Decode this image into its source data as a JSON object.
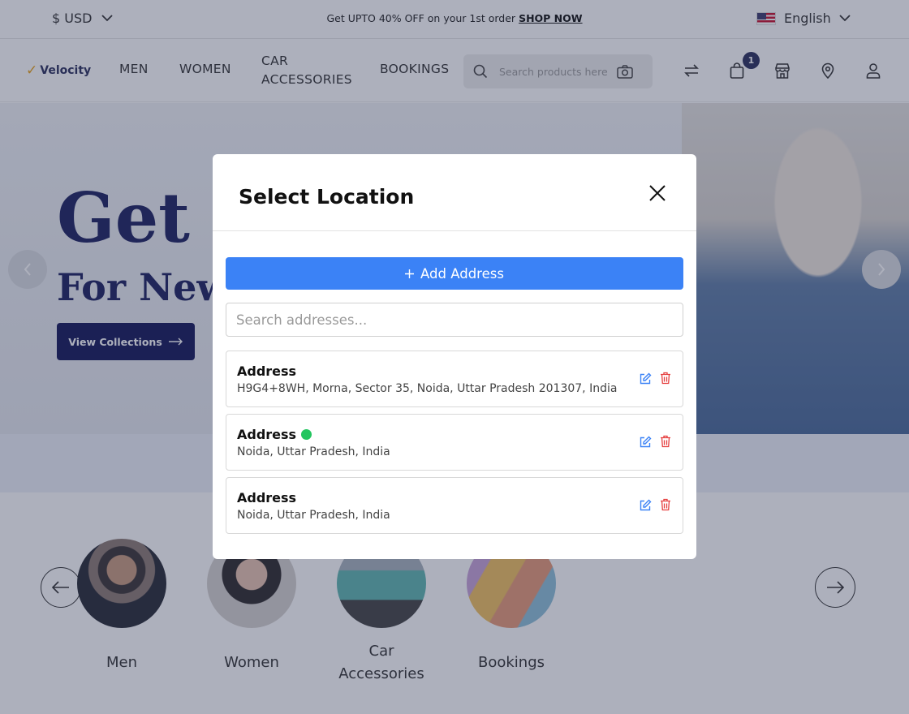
{
  "topbar": {
    "currency": "$ USD",
    "promo_text": "Get UPTO 40% OFF on your 1st order",
    "promo_link": "SHOP NOW",
    "language": "English"
  },
  "nav": {
    "logo_text": "Velocity",
    "links": [
      "MEN",
      "WOMEN",
      "CAR",
      "ACCESSORIES",
      "BOOKINGS"
    ],
    "search_placeholder": "Search products here",
    "cart_count": "1"
  },
  "hero": {
    "headline": "Get B",
    "subheadline": "For New",
    "cta_label": "View Collections"
  },
  "categories": {
    "items": [
      {
        "label": "Men"
      },
      {
        "label": "Women"
      },
      {
        "label": "Car Accessories"
      },
      {
        "label": "Bookings"
      }
    ]
  },
  "modal": {
    "title": "Select Location",
    "add_button_label": "Add Address",
    "search_placeholder": "Search addresses...",
    "addresses": [
      {
        "title": "Address",
        "text": "H9G4+8WH, Morna, Sector 35, Noida, Uttar Pradesh 201307, India",
        "active": false
      },
      {
        "title": "Address",
        "text": "Noida, Uttar Pradesh, India",
        "active": true
      },
      {
        "title": "Address",
        "text": "Noida, Uttar Pradesh, India",
        "active": false
      }
    ]
  },
  "colors": {
    "primary_button": "#3b82f6",
    "delete_icon": "#e53e3e",
    "edit_icon": "#3b82f6",
    "active_dot": "#22c55e",
    "brand_navy": "#1c2160"
  },
  "icons": [
    "chevron-down-icon",
    "flag-us-icon",
    "search-icon",
    "camera-icon",
    "compare-icon",
    "cart-icon",
    "store-icon",
    "location-pin-icon",
    "user-icon",
    "close-icon",
    "plus-icon",
    "edit-icon",
    "trash-icon",
    "arrow-left-icon",
    "arrow-right-icon"
  ]
}
